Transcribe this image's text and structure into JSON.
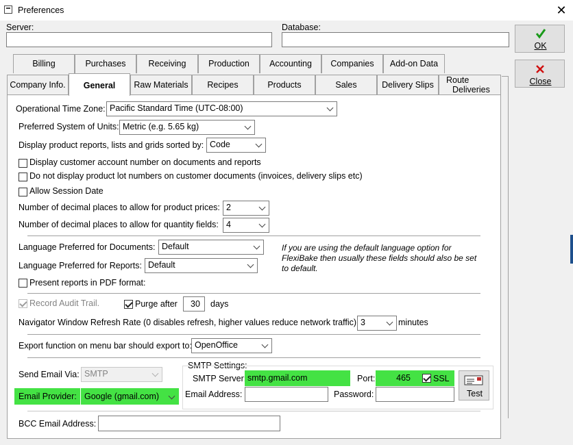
{
  "window": {
    "title": "Preferences"
  },
  "connection": {
    "server_label": "Server:",
    "server_value": "",
    "database_label": "Database:",
    "database_value": ""
  },
  "buttons": {
    "ok": "OK",
    "close": "Close"
  },
  "tabs_row1": [
    "Billing",
    "Purchases",
    "Receiving",
    "Production",
    "Accounting",
    "Companies",
    "Add-on Data"
  ],
  "tabs_row2": [
    "Company Info.",
    "General",
    "Raw Materials",
    "Recipes",
    "Products",
    "Sales",
    "Delivery Slips",
    "Route",
    "Deliveries"
  ],
  "general": {
    "timezone_label": "Operational Time Zone:",
    "timezone_value": "Pacific Standard Time (UTC-08:00)",
    "units_label": "Preferred System of Units:",
    "units_value": "Metric (e.g. 5.65 kg)",
    "sort_label": "Display product reports, lists and grids sorted by:",
    "sort_value": "Code",
    "chk_account_number": "Display customer account number on documents and reports",
    "chk_lot_numbers": "Do not display product lot numbers on customer documents (invoices, delivery slips etc)",
    "chk_session_date": "Allow Session Date",
    "price_decimals_label": "Number of decimal places to allow for product prices:",
    "price_decimals_value": "2",
    "qty_decimals_label": "Number of decimal places to allow for quantity fields:",
    "qty_decimals_value": "4",
    "lang_docs_label": "Language Preferred for Documents:",
    "lang_docs_value": "Default",
    "lang_reports_label": "Language Preferred for Reports:",
    "lang_reports_value": "Default",
    "lang_note": "If you are using the default language option for FlexiBake then usually these fields should also be set to default.",
    "chk_pdf": "Present reports in PDF format:",
    "chk_audit": "Record Audit Trail.",
    "chk_purge": "Purge after",
    "purge_days_value": "30",
    "purge_days_unit": "days",
    "refresh_label": "Navigator Window Refresh Rate (0 disables refresh, higher values reduce network traffic)",
    "refresh_value": "3",
    "refresh_unit": "minutes",
    "export_label": "Export function on menu bar should export to:",
    "export_value": "OpenOffice",
    "send_email_label": "Send Email Via:",
    "send_email_value": "SMTP",
    "email_provider_label": "Email Provider:",
    "email_provider_value": "Google (gmail.com)",
    "smtp_group_label": "SMTP Settings:",
    "smtp_server_label": "SMTP Server:",
    "smtp_server_value": "smtp.gmail.com",
    "port_label": "Port:",
    "port_value": "465",
    "ssl_label": "SSL",
    "email_address_label": "Email Address:",
    "email_address_value": "",
    "password_label": "Password:",
    "password_value": "",
    "test_label": "Test",
    "bcc_label": "BCC Email Address:",
    "bcc_value": ""
  },
  "colors": {
    "highlight": "#44e244",
    "ok_check": "#1a9a1a",
    "close_x": "#d01010"
  }
}
